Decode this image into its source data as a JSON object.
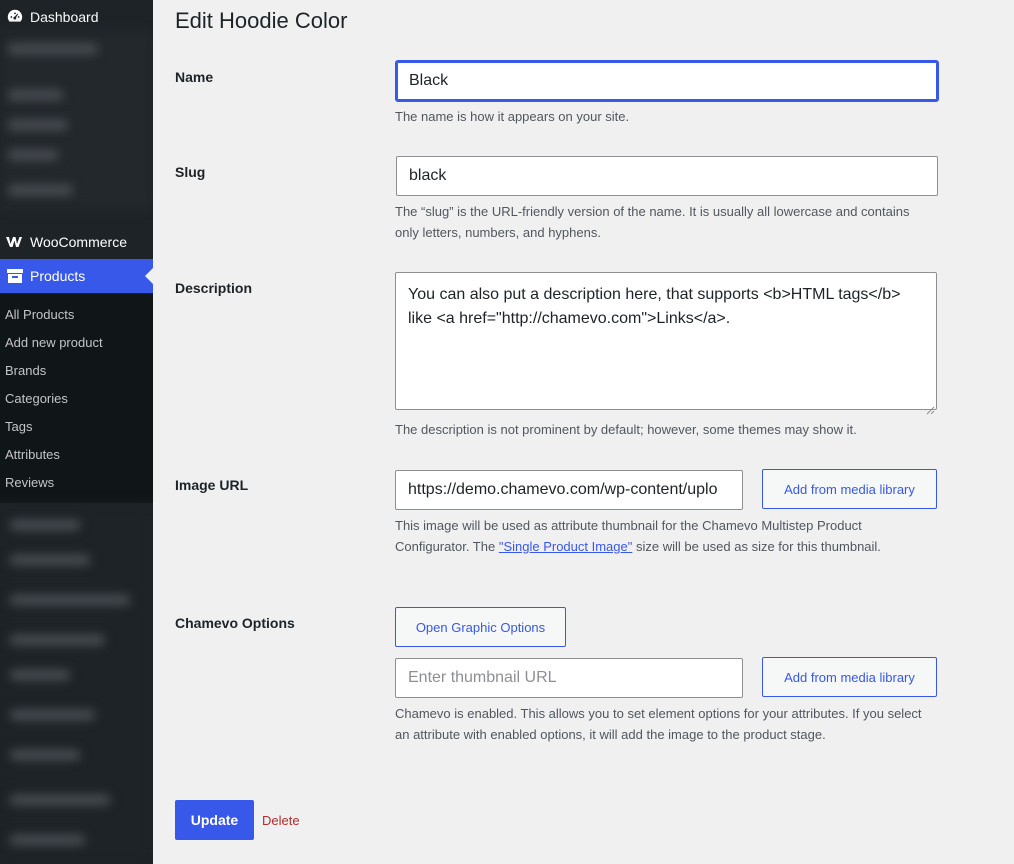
{
  "sidebar": {
    "dashboard_label": "Dashboard",
    "woocommerce_label": "WooCommerce",
    "products_label": "Products",
    "submenu": [
      "All Products",
      "Add new product",
      "Brands",
      "Categories",
      "Tags",
      "Attributes",
      "Reviews"
    ],
    "icons": {
      "dashboard": "dashboard-gauge-icon",
      "woocommerce": "woocommerce-logo-icon",
      "products": "archive-box-icon"
    },
    "accent_color": "#3858e9"
  },
  "page": {
    "title": "Edit Hoodie Color"
  },
  "form": {
    "name": {
      "label": "Name",
      "value": "Black",
      "help": "The name is how it appears on your site."
    },
    "slug": {
      "label": "Slug",
      "value": "black",
      "help": "The “slug” is the URL-friendly version of the name. It is usually all lowercase and contains only letters, numbers, and hyphens."
    },
    "description": {
      "label": "Description",
      "value": "You can also put a description here, that supports <b>HTML tags</b> like <a href=\"http://chamevo.com\">Links</a>.",
      "help": "The description is not prominent by default; however, some themes may show it."
    },
    "image_url": {
      "label": "Image URL",
      "value": "https://demo.chamevo.com/wp-content/uplo",
      "button": "Add from media library",
      "help_before": "This image will be used as attribute thumbnail for the Chamevo Multistep Product Configurator. The ",
      "help_link": "\"Single Product Image\"",
      "help_after": " size will be used as size for this thumbnail."
    },
    "chamevo_options": {
      "label": "Chamevo Options",
      "open_button": "Open Graphic Options",
      "thumbnail_placeholder": "Enter thumbnail URL",
      "button": "Add from media library",
      "help": "Chamevo is enabled. This allows you to set element options for your attributes. If you select an attribute with enabled options, it will add the image to the product stage."
    },
    "update_button": "Update",
    "delete_link": "Delete"
  }
}
